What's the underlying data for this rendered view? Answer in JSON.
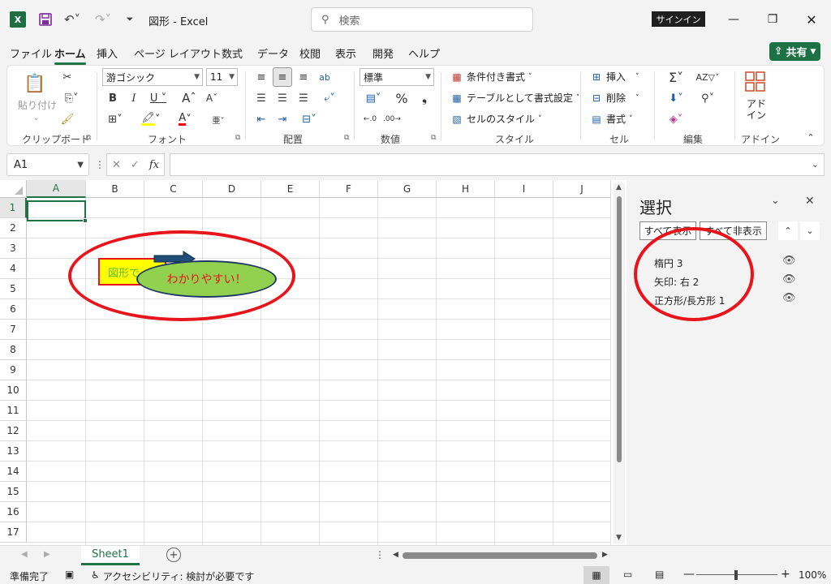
{
  "titlebar": {
    "doc_title": "図形  -  Excel",
    "search_placeholder": "検索",
    "signin": "サインイン"
  },
  "menu": {
    "tabs": [
      "ファイル",
      "ホーム",
      "挿入",
      "ページ レイアウト",
      "数式",
      "データ",
      "校閲",
      "表示",
      "開発",
      "ヘルプ"
    ],
    "active": "ホーム",
    "share": "共有"
  },
  "ribbon": {
    "clipboard": {
      "paste": "貼り付け",
      "label": "クリップボード"
    },
    "font": {
      "name": "游ゴシック",
      "size": "11",
      "label": "フォント"
    },
    "alignment": {
      "label": "配置"
    },
    "number": {
      "format": "標準",
      "label": "数値"
    },
    "styles": {
      "conditional": "条件付き書式",
      "table": "テーブルとして書式設定",
      "cell_styles": "セルのスタイル",
      "label": "スタイル"
    },
    "cells": {
      "insert": "挿入",
      "delete": "削除",
      "format": "書式",
      "label": "セル"
    },
    "editing": {
      "label": "編集"
    },
    "addins": {
      "button": "アド\nイン",
      "label": "アドイン"
    }
  },
  "formula_bar": {
    "name_box": "A1",
    "fx": "fx"
  },
  "grid": {
    "columns": [
      "A",
      "B",
      "C",
      "D",
      "E",
      "F",
      "G",
      "H",
      "I",
      "J"
    ],
    "rows": [
      "1",
      "2",
      "3",
      "4",
      "5",
      "6",
      "7",
      "8",
      "9",
      "10",
      "11",
      "12",
      "13",
      "14",
      "15",
      "16",
      "17"
    ],
    "rect_text": "図形で",
    "ellipse_text": "わかりやすい！"
  },
  "selection_pane": {
    "title": "選択",
    "show_all": "すべて表示",
    "hide_all": "すべて非表示",
    "items": [
      "楕円 3",
      "矢印: 右 2",
      "正方形/長方形 1"
    ]
  },
  "sheets": {
    "tabs": [
      "Sheet1"
    ],
    "active": "Sheet1"
  },
  "status": {
    "ready": "準備完了",
    "accessibility": "アクセシビリティ: 検討が必要です",
    "zoom": "100%"
  },
  "colors": {
    "accent": "#217346",
    "highlight": "#e8141b"
  }
}
